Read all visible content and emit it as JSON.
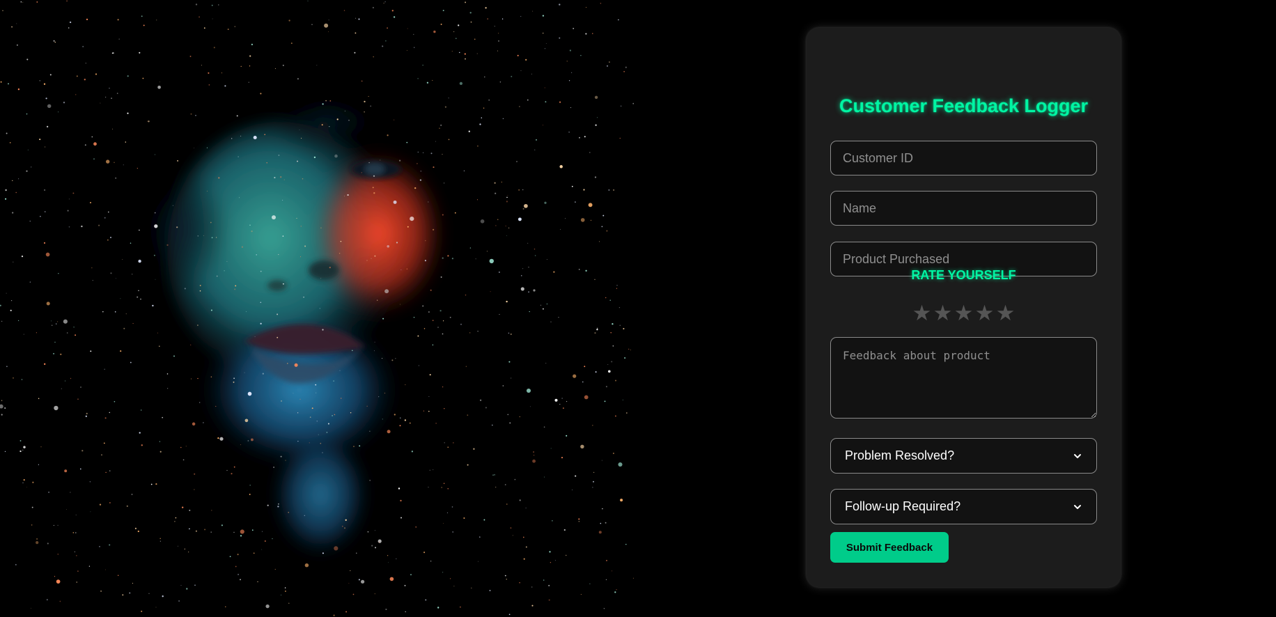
{
  "form": {
    "title": "Customer Feedback Logger",
    "customer_id_placeholder": "Customer ID",
    "name_placeholder": "Name",
    "product_placeholder": "Product Purchased",
    "rate_label": "RATE YOURSELF",
    "rating": {
      "value": 0,
      "max": 5,
      "star_glyph": "★"
    },
    "feedback_placeholder": "Feedback about product",
    "problem_resolved_selected": "Problem Resolved?",
    "follow_up_selected": "Follow-up Required?",
    "submit_label": "Submit Feedback"
  },
  "colors": {
    "accent": "#00f5a3",
    "button": "#00cc8a",
    "card_bg": "#1c1c1c",
    "page_bg": "#000000",
    "star_inactive": "#555555"
  }
}
